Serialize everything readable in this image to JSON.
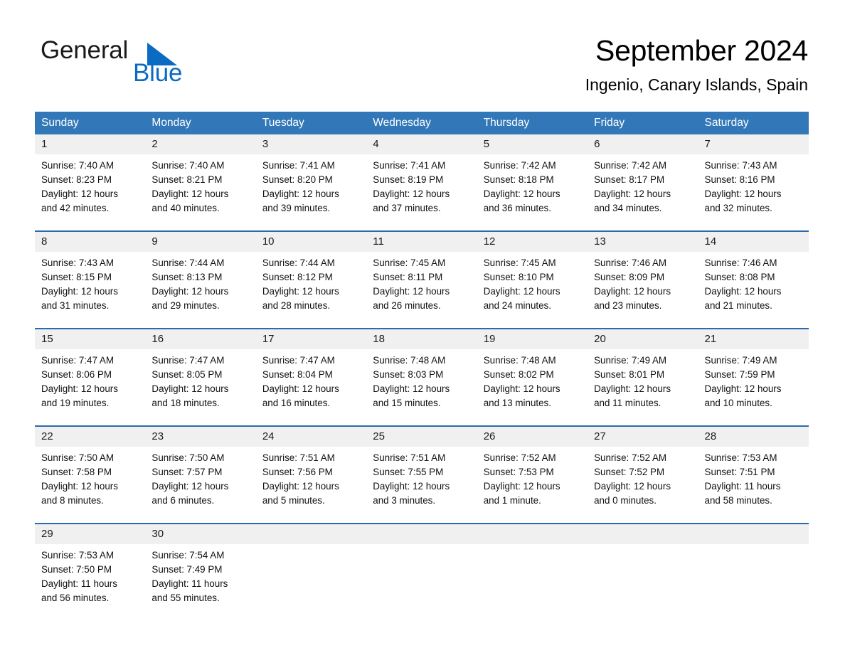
{
  "brand": {
    "name_dark": "General",
    "name_blue": "Blue",
    "triangle_color": "#0b6bc2",
    "blue_text_color": "#0b6bc2",
    "dark_text_color": "#1a1a1a"
  },
  "header": {
    "title": "September 2024",
    "subtitle": "Ingenio, Canary Islands, Spain"
  },
  "colors": {
    "header_blue": "#3278b8",
    "row_divider_blue": "#2a6aad",
    "daynum_band_gray": "#f0f0f0",
    "page_background": "#ffffff"
  },
  "weekdays": [
    "Sunday",
    "Monday",
    "Tuesday",
    "Wednesday",
    "Thursday",
    "Friday",
    "Saturday"
  ],
  "weeks": [
    [
      {
        "day": "1",
        "sunrise": "Sunrise: 7:40 AM",
        "sunset": "Sunset: 8:23 PM",
        "daylight_line1": "Daylight: 12 hours",
        "daylight_line2": "and 42 minutes."
      },
      {
        "day": "2",
        "sunrise": "Sunrise: 7:40 AM",
        "sunset": "Sunset: 8:21 PM",
        "daylight_line1": "Daylight: 12 hours",
        "daylight_line2": "and 40 minutes."
      },
      {
        "day": "3",
        "sunrise": "Sunrise: 7:41 AM",
        "sunset": "Sunset: 8:20 PM",
        "daylight_line1": "Daylight: 12 hours",
        "daylight_line2": "and 39 minutes."
      },
      {
        "day": "4",
        "sunrise": "Sunrise: 7:41 AM",
        "sunset": "Sunset: 8:19 PM",
        "daylight_line1": "Daylight: 12 hours",
        "daylight_line2": "and 37 minutes."
      },
      {
        "day": "5",
        "sunrise": "Sunrise: 7:42 AM",
        "sunset": "Sunset: 8:18 PM",
        "daylight_line1": "Daylight: 12 hours",
        "daylight_line2": "and 36 minutes."
      },
      {
        "day": "6",
        "sunrise": "Sunrise: 7:42 AM",
        "sunset": "Sunset: 8:17 PM",
        "daylight_line1": "Daylight: 12 hours",
        "daylight_line2": "and 34 minutes."
      },
      {
        "day": "7",
        "sunrise": "Sunrise: 7:43 AM",
        "sunset": "Sunset: 8:16 PM",
        "daylight_line1": "Daylight: 12 hours",
        "daylight_line2": "and 32 minutes."
      }
    ],
    [
      {
        "day": "8",
        "sunrise": "Sunrise: 7:43 AM",
        "sunset": "Sunset: 8:15 PM",
        "daylight_line1": "Daylight: 12 hours",
        "daylight_line2": "and 31 minutes."
      },
      {
        "day": "9",
        "sunrise": "Sunrise: 7:44 AM",
        "sunset": "Sunset: 8:13 PM",
        "daylight_line1": "Daylight: 12 hours",
        "daylight_line2": "and 29 minutes."
      },
      {
        "day": "10",
        "sunrise": "Sunrise: 7:44 AM",
        "sunset": "Sunset: 8:12 PM",
        "daylight_line1": "Daylight: 12 hours",
        "daylight_line2": "and 28 minutes."
      },
      {
        "day": "11",
        "sunrise": "Sunrise: 7:45 AM",
        "sunset": "Sunset: 8:11 PM",
        "daylight_line1": "Daylight: 12 hours",
        "daylight_line2": "and 26 minutes."
      },
      {
        "day": "12",
        "sunrise": "Sunrise: 7:45 AM",
        "sunset": "Sunset: 8:10 PM",
        "daylight_line1": "Daylight: 12 hours",
        "daylight_line2": "and 24 minutes."
      },
      {
        "day": "13",
        "sunrise": "Sunrise: 7:46 AM",
        "sunset": "Sunset: 8:09 PM",
        "daylight_line1": "Daylight: 12 hours",
        "daylight_line2": "and 23 minutes."
      },
      {
        "day": "14",
        "sunrise": "Sunrise: 7:46 AM",
        "sunset": "Sunset: 8:08 PM",
        "daylight_line1": "Daylight: 12 hours",
        "daylight_line2": "and 21 minutes."
      }
    ],
    [
      {
        "day": "15",
        "sunrise": "Sunrise: 7:47 AM",
        "sunset": "Sunset: 8:06 PM",
        "daylight_line1": "Daylight: 12 hours",
        "daylight_line2": "and 19 minutes."
      },
      {
        "day": "16",
        "sunrise": "Sunrise: 7:47 AM",
        "sunset": "Sunset: 8:05 PM",
        "daylight_line1": "Daylight: 12 hours",
        "daylight_line2": "and 18 minutes."
      },
      {
        "day": "17",
        "sunrise": "Sunrise: 7:47 AM",
        "sunset": "Sunset: 8:04 PM",
        "daylight_line1": "Daylight: 12 hours",
        "daylight_line2": "and 16 minutes."
      },
      {
        "day": "18",
        "sunrise": "Sunrise: 7:48 AM",
        "sunset": "Sunset: 8:03 PM",
        "daylight_line1": "Daylight: 12 hours",
        "daylight_line2": "and 15 minutes."
      },
      {
        "day": "19",
        "sunrise": "Sunrise: 7:48 AM",
        "sunset": "Sunset: 8:02 PM",
        "daylight_line1": "Daylight: 12 hours",
        "daylight_line2": "and 13 minutes."
      },
      {
        "day": "20",
        "sunrise": "Sunrise: 7:49 AM",
        "sunset": "Sunset: 8:01 PM",
        "daylight_line1": "Daylight: 12 hours",
        "daylight_line2": "and 11 minutes."
      },
      {
        "day": "21",
        "sunrise": "Sunrise: 7:49 AM",
        "sunset": "Sunset: 7:59 PM",
        "daylight_line1": "Daylight: 12 hours",
        "daylight_line2": "and 10 minutes."
      }
    ],
    [
      {
        "day": "22",
        "sunrise": "Sunrise: 7:50 AM",
        "sunset": "Sunset: 7:58 PM",
        "daylight_line1": "Daylight: 12 hours",
        "daylight_line2": "and 8 minutes."
      },
      {
        "day": "23",
        "sunrise": "Sunrise: 7:50 AM",
        "sunset": "Sunset: 7:57 PM",
        "daylight_line1": "Daylight: 12 hours",
        "daylight_line2": "and 6 minutes."
      },
      {
        "day": "24",
        "sunrise": "Sunrise: 7:51 AM",
        "sunset": "Sunset: 7:56 PM",
        "daylight_line1": "Daylight: 12 hours",
        "daylight_line2": "and 5 minutes."
      },
      {
        "day": "25",
        "sunrise": "Sunrise: 7:51 AM",
        "sunset": "Sunset: 7:55 PM",
        "daylight_line1": "Daylight: 12 hours",
        "daylight_line2": "and 3 minutes."
      },
      {
        "day": "26",
        "sunrise": "Sunrise: 7:52 AM",
        "sunset": "Sunset: 7:53 PM",
        "daylight_line1": "Daylight: 12 hours",
        "daylight_line2": "and 1 minute."
      },
      {
        "day": "27",
        "sunrise": "Sunrise: 7:52 AM",
        "sunset": "Sunset: 7:52 PM",
        "daylight_line1": "Daylight: 12 hours",
        "daylight_line2": "and 0 minutes."
      },
      {
        "day": "28",
        "sunrise": "Sunrise: 7:53 AM",
        "sunset": "Sunset: 7:51 PM",
        "daylight_line1": "Daylight: 11 hours",
        "daylight_line2": "and 58 minutes."
      }
    ],
    [
      {
        "day": "29",
        "sunrise": "Sunrise: 7:53 AM",
        "sunset": "Sunset: 7:50 PM",
        "daylight_line1": "Daylight: 11 hours",
        "daylight_line2": "and 56 minutes."
      },
      {
        "day": "30",
        "sunrise": "Sunrise: 7:54 AM",
        "sunset": "Sunset: 7:49 PM",
        "daylight_line1": "Daylight: 11 hours",
        "daylight_line2": "and 55 minutes."
      },
      {
        "day": "",
        "sunrise": "",
        "sunset": "",
        "daylight_line1": "",
        "daylight_line2": ""
      },
      {
        "day": "",
        "sunrise": "",
        "sunset": "",
        "daylight_line1": "",
        "daylight_line2": ""
      },
      {
        "day": "",
        "sunrise": "",
        "sunset": "",
        "daylight_line1": "",
        "daylight_line2": ""
      },
      {
        "day": "",
        "sunrise": "",
        "sunset": "",
        "daylight_line1": "",
        "daylight_line2": ""
      },
      {
        "day": "",
        "sunrise": "",
        "sunset": "",
        "daylight_line1": "",
        "daylight_line2": ""
      }
    ]
  ]
}
